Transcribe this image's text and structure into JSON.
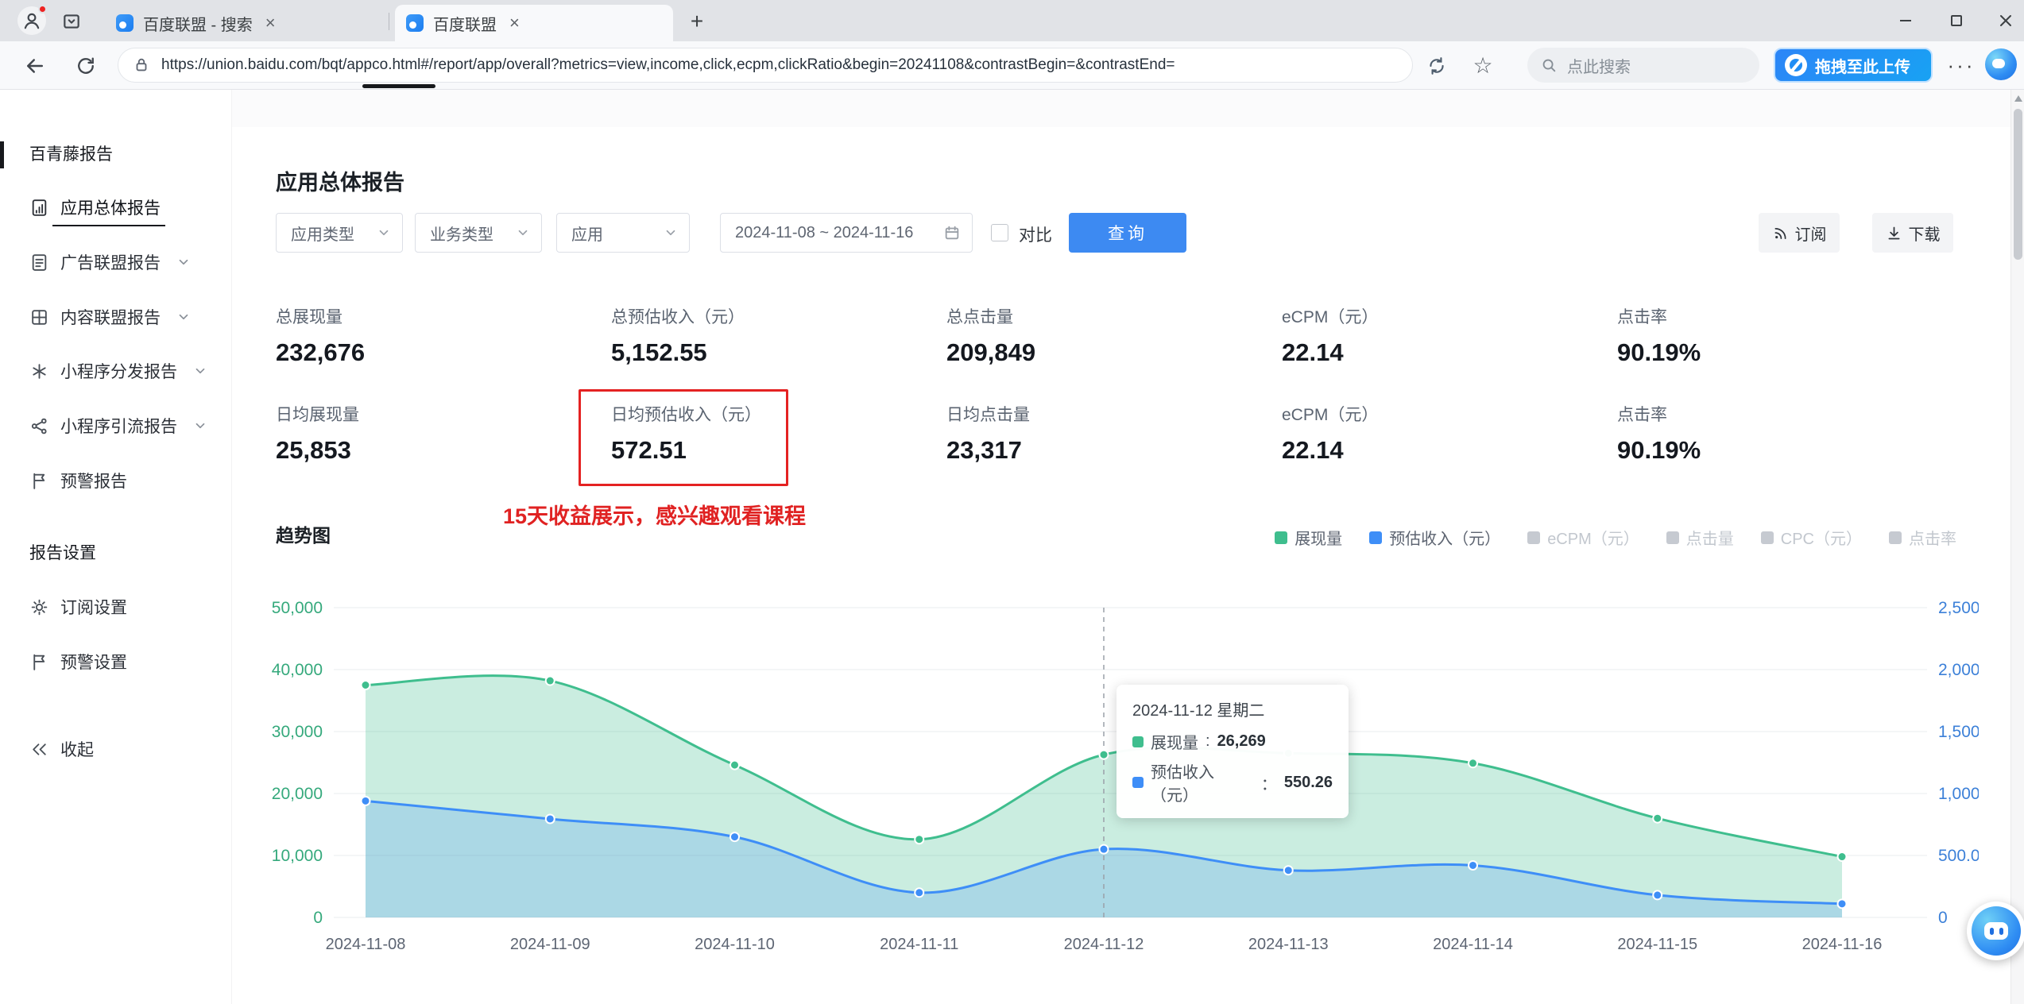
{
  "browser": {
    "tabs": [
      {
        "title": "百度联盟 - 搜索",
        "active": false
      },
      {
        "title": "百度联盟",
        "active": true
      }
    ],
    "url": "https://union.baidu.com/bqt/appco.html#/report/app/overall?metrics=view,income,click,ecpm,clickRatio&begin=20241108&contrastBegin=&contrastEnd=",
    "search_placeholder": "点此搜索",
    "upload_button": "拖拽至此上传"
  },
  "sidebar": {
    "section_report": "百青藤报告",
    "items": [
      {
        "label": "应用总体报告",
        "active": true
      },
      {
        "label": "广告联盟报告",
        "expandable": true
      },
      {
        "label": "内容联盟报告",
        "expandable": true
      },
      {
        "label": "小程序分发报告",
        "expandable": true
      },
      {
        "label": "小程序引流报告",
        "expandable": true
      },
      {
        "label": "预警报告"
      }
    ],
    "section_settings": "报告设置",
    "settings_items": [
      {
        "label": "订阅设置"
      },
      {
        "label": "预警设置"
      }
    ],
    "collapse_label": "收起"
  },
  "main": {
    "title": "应用总体报告",
    "trend_title": "趋势图",
    "annotation": "15天收益展示，感兴趣观看课程",
    "annotation_color": "#e02222"
  },
  "filters": {
    "app_type": "应用类型",
    "biz_type": "业务类型",
    "app": "应用",
    "date_range": "2024-11-08 ~ 2024-11-16",
    "contrast": "对比",
    "query": "查询",
    "subscribe": "订阅",
    "download": "下载",
    "query_color": "#3d8af2"
  },
  "stats": {
    "row1": [
      {
        "label": "总展现量",
        "value": "232,676"
      },
      {
        "label": "总预估收入（元）",
        "value": "5,152.55"
      },
      {
        "label": "总点击量",
        "value": "209,849"
      },
      {
        "label": "eCPM（元）",
        "value": "22.14"
      },
      {
        "label": "点击率",
        "value": "90.19%"
      }
    ],
    "row2": [
      {
        "label": "日均展现量",
        "value": "25,853"
      },
      {
        "label": "日均预估收入（元）",
        "value": "572.51"
      },
      {
        "label": "日均点击量",
        "value": "23,317"
      },
      {
        "label": "eCPM（元）",
        "value": "22.14"
      },
      {
        "label": "点击率",
        "value": "90.19%"
      }
    ]
  },
  "chart_data": {
    "type": "area",
    "title": "趋势图",
    "x": [
      "2024-11-08",
      "2024-11-09",
      "2024-11-10",
      "2024-11-11",
      "2024-11-12",
      "2024-11-13",
      "2024-11-14",
      "2024-11-15",
      "2024-11-16"
    ],
    "series": [
      {
        "name": "展现量",
        "axis": "left",
        "color": "#3fbe8e",
        "fill": "rgba(63,190,142,0.28)",
        "values": [
          37500,
          38200,
          24600,
          12600,
          26269,
          26500,
          24900,
          16000,
          9800
        ]
      },
      {
        "name": "预估收入（元）",
        "axis": "right",
        "color": "#3e8ef7",
        "fill": "rgba(62,142,247,0.22)",
        "values": [
          940,
          795,
          650,
          200,
          550.26,
          380,
          420,
          180,
          110
        ]
      }
    ],
    "left_axis": {
      "min": 0,
      "max": 50000,
      "color": "#35a97c",
      "ticks": [
        "0",
        "10,000",
        "20,000",
        "30,000",
        "40,000",
        "50,000"
      ]
    },
    "right_axis": {
      "min": 0,
      "max": 2500,
      "color": "#3c80d8",
      "ticks": [
        "0",
        "500.00",
        "1,000.00",
        "1,500.00",
        "2,000.00",
        "2,500.00"
      ]
    },
    "legend": [
      {
        "label": "展现量",
        "color": "#3fbe8e",
        "active": true
      },
      {
        "label": "预估收入（元）",
        "color": "#3e8ef7",
        "active": true
      },
      {
        "label": "eCPM（元）",
        "color": "#c6cad1",
        "active": false
      },
      {
        "label": "点击量",
        "color": "#c6cad1",
        "active": false
      },
      {
        "label": "CPC（元）",
        "color": "#c6cad1",
        "active": false
      },
      {
        "label": "点击率",
        "color": "#c6cad1",
        "active": false
      }
    ],
    "hover_index": 4,
    "grid": true,
    "legend_position": "top-right"
  },
  "tooltip": {
    "title": "2024-11-12 星期二",
    "rows": [
      {
        "label": "展现量",
        "sep": ": ",
        "value": "26,269",
        "color": "#3fbe8e"
      },
      {
        "label": "预估收入（元）",
        "sep": "：",
        "value": "550.26",
        "color": "#3e8ef7"
      }
    ]
  }
}
